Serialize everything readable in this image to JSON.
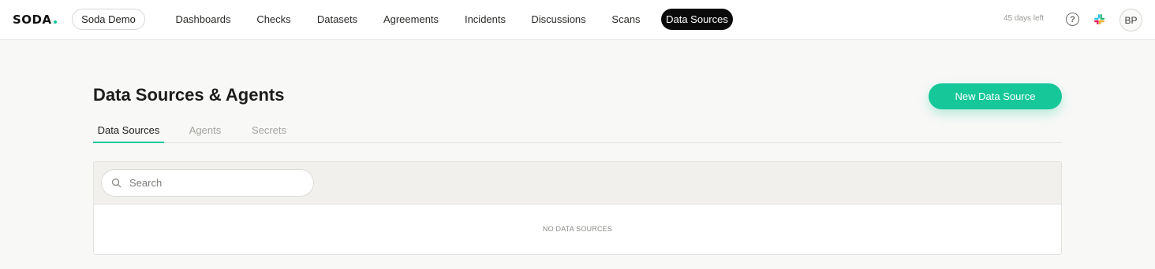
{
  "brand": {
    "logo_text": "SODA",
    "accent": "#16c79a"
  },
  "header": {
    "workspace": "Soda Demo",
    "nav": [
      {
        "label": "Dashboards",
        "active": false
      },
      {
        "label": "Checks",
        "active": false
      },
      {
        "label": "Datasets",
        "active": false
      },
      {
        "label": "Agreements",
        "active": false
      },
      {
        "label": "Incidents",
        "active": false
      },
      {
        "label": "Discussions",
        "active": false
      },
      {
        "label": "Scans",
        "active": false
      },
      {
        "label": "Data Sources",
        "active": true
      }
    ],
    "trial_text": "45 days left",
    "help_icon": "help-circle-icon",
    "integration_icon": "slack-icon",
    "avatar_initials": "BP"
  },
  "page": {
    "title": "Data Sources & Agents",
    "primary_action": "New Data Source",
    "tabs": [
      {
        "label": "Data Sources",
        "active": true
      },
      {
        "label": "Agents",
        "active": false
      },
      {
        "label": "Secrets",
        "active": false
      }
    ],
    "search": {
      "placeholder": "Search",
      "value": "",
      "icon": "search-icon"
    },
    "empty_message": "NO DATA SOURCES"
  }
}
